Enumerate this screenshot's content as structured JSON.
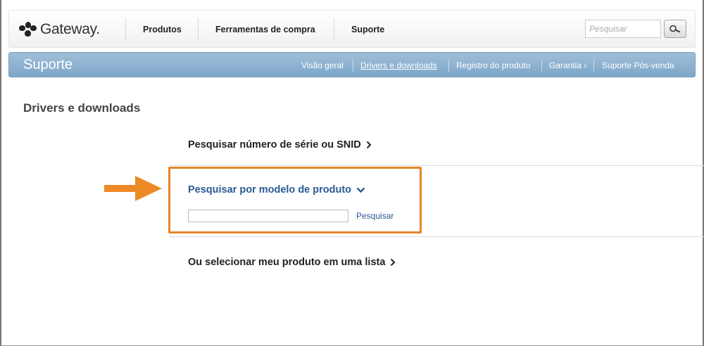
{
  "brand": {
    "name": "Gateway."
  },
  "topnav": {
    "items": [
      {
        "label": "Produtos"
      },
      {
        "label": "Ferramentas de compra"
      },
      {
        "label": "Suporte"
      }
    ],
    "search_placeholder": "Pesquisar"
  },
  "supportbar": {
    "title": "Suporte",
    "items": [
      {
        "label": "Visão geral"
      },
      {
        "label": "Drivers e downloads"
      },
      {
        "label": "Registro do produto"
      },
      {
        "label": "Garantia ›"
      },
      {
        "label": "Suporte Pós-venda"
      }
    ],
    "active_index": 1
  },
  "main": {
    "page_title": "Drivers e downloads",
    "serial_search_label": "Pesquisar número de série ou SNID",
    "model_search": {
      "title": "Pesquisar por modelo de produto",
      "input_value": "",
      "button_label": "Pesquisar"
    },
    "list_select_label": "Ou selecionar meu produto em uma lista"
  },
  "colors": {
    "accent_blue": "#285a94",
    "support_bar": "#8fb3d2",
    "highlight_orange": "#e5852b"
  },
  "icons": [
    "gateway-logo-icon",
    "search-icon",
    "chevron-right-icon",
    "chevron-down-icon",
    "orange-arrow-icon"
  ]
}
